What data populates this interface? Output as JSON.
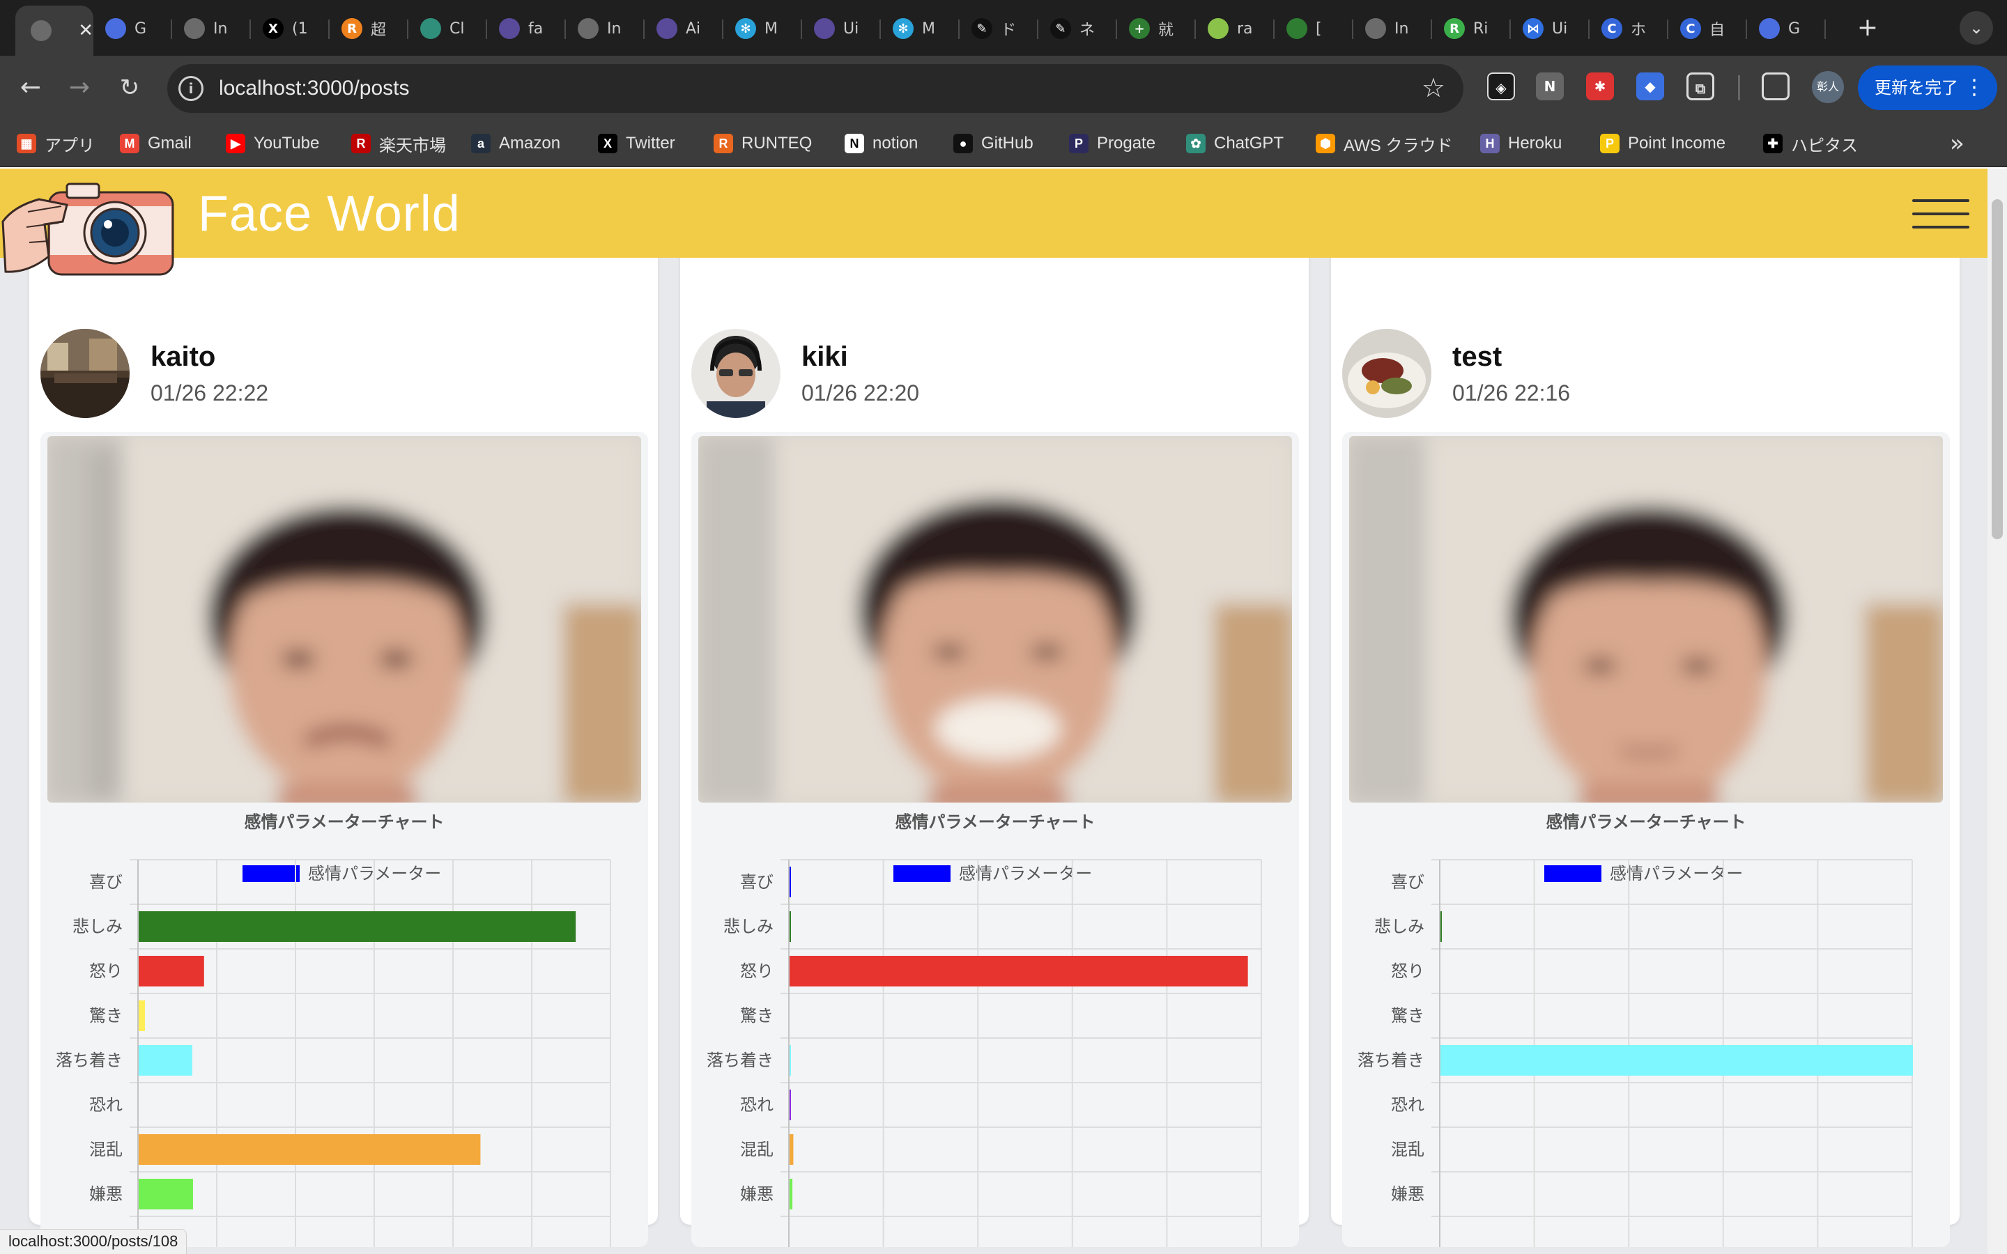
{
  "browser": {
    "tabs": [
      {
        "title": "",
        "icon": "globe-icon",
        "active": true
      },
      {
        "title": "G",
        "icon": "refresh-c-icon"
      },
      {
        "title": "In",
        "icon": "globe-icon"
      },
      {
        "title": "(1",
        "icon": "x-logo-icon"
      },
      {
        "title": "超",
        "icon": "r-logo-icon"
      },
      {
        "title": "Cl",
        "icon": "openai-icon"
      },
      {
        "title": "fa",
        "icon": "circle-icon"
      },
      {
        "title": "In",
        "icon": "globe-icon"
      },
      {
        "title": "Ai",
        "icon": "circle-icon"
      },
      {
        "title": "M",
        "icon": "snowflake-icon"
      },
      {
        "title": "Ui",
        "icon": "circle-icon"
      },
      {
        "title": "M",
        "icon": "snowflake-icon"
      },
      {
        "title": "ド",
        "icon": "feather-icon"
      },
      {
        "title": "ネ",
        "icon": "feather-icon"
      },
      {
        "title": "就",
        "icon": "plus-circle-icon"
      },
      {
        "title": "ra",
        "icon": "square-app-icon"
      },
      {
        "title": "[",
        "icon": "green-circle-icon"
      },
      {
        "title": "In",
        "icon": "globe-icon"
      },
      {
        "title": "Ri",
        "icon": "green-r-icon"
      },
      {
        "title": "Ui",
        "icon": "share-icon"
      },
      {
        "title": "ホ",
        "icon": "c-logo-icon"
      },
      {
        "title": "自",
        "icon": "c-logo-icon"
      },
      {
        "title": "G",
        "icon": "refresh-c-icon"
      }
    ],
    "url": "localhost:3000/posts",
    "update_button": "更新を完了",
    "profile": "彰人",
    "bookmarks": [
      {
        "label": "アプリ",
        "icon": "apps-grid-icon"
      },
      {
        "label": "Gmail",
        "icon": "gmail-icon"
      },
      {
        "label": "YouTube",
        "icon": "youtube-icon"
      },
      {
        "label": "楽天市場",
        "icon": "rakuten-icon"
      },
      {
        "label": "Amazon",
        "icon": "amazon-icon"
      },
      {
        "label": "Twitter",
        "icon": "x-logo-icon"
      },
      {
        "label": "RUNTEQ",
        "icon": "runteq-icon"
      },
      {
        "label": "notion",
        "icon": "notion-icon"
      },
      {
        "label": "GitHub",
        "icon": "github-icon"
      },
      {
        "label": "Progate",
        "icon": "progate-icon"
      },
      {
        "label": "ChatGPT",
        "icon": "openai-icon"
      },
      {
        "label": "AWS クラウド",
        "icon": "aws-icon"
      },
      {
        "label": "Heroku",
        "icon": "heroku-icon"
      },
      {
        "label": "Point Income",
        "icon": "point-income-icon"
      },
      {
        "label": "ハピタス",
        "icon": "hapitas-icon"
      }
    ],
    "status_url": "localhost:3000/posts/108"
  },
  "site": {
    "brand": "Face World",
    "colors": {
      "header": "#f3cc47",
      "brand_text": "#ffffff"
    }
  },
  "posts": [
    {
      "user": "kaito",
      "date": "01/26 22:22",
      "avatar": "dining-room-avatar"
    },
    {
      "user": "kiki",
      "date": "01/26 22:20",
      "avatar": "person-headset-avatar"
    },
    {
      "user": "test",
      "date": "01/26 22:16",
      "avatar": "food-plate-avatar"
    }
  ],
  "chart_data": [
    {
      "type": "bar",
      "orientation": "horizontal",
      "title": "感情パラメーターチャート",
      "legend": "感情パラメーター",
      "legend_color": "#0000ff",
      "categories": [
        "喜び",
        "悲しみ",
        "怒り",
        "驚き",
        "落ち着き",
        "恐れ",
        "混乱",
        "嫌悪"
      ],
      "values": [
        0,
        5550,
        830,
        80,
        680,
        0,
        4340,
        690
      ],
      "colors": [
        "#0000ff",
        "#2e7d22",
        "#e8342e",
        "#ffee58",
        "#7ef7ff",
        "#8a2be2",
        "#f4a93c",
        "#72f052"
      ],
      "xlim": [
        0,
        6000
      ],
      "xticks": [
        "0",
        "1,000",
        "2,000",
        "3,000",
        "4,000",
        "5,000",
        "6,000"
      ]
    },
    {
      "type": "bar",
      "orientation": "horizontal",
      "title": "感情パラメーターチャート",
      "legend": "感情パラメーター",
      "legend_color": "#0000ff",
      "categories": [
        "喜び",
        "悲しみ",
        "怒り",
        "驚き",
        "落ち着き",
        "恐れ",
        "混乱",
        "嫌悪"
      ],
      "values": [
        20,
        10,
        9700,
        0,
        5,
        10,
        80,
        60
      ],
      "colors": [
        "#0000ff",
        "#2e7d22",
        "#e8342e",
        "#ffee58",
        "#7ef7ff",
        "#8a2be2",
        "#f4a93c",
        "#72f052"
      ],
      "xlim": [
        0,
        10000
      ],
      "xticks": [
        "0",
        "2,000",
        "4,000",
        "6,000",
        "8,000",
        "10,000"
      ]
    },
    {
      "type": "bar",
      "orientation": "horizontal",
      "title": "感情パラメーターチャート",
      "legend": "感情パラメーター",
      "legend_color": "#0000ff",
      "categories": [
        "喜び",
        "悲しみ",
        "怒り",
        "驚き",
        "落ち着き",
        "恐れ",
        "混乱",
        "嫌悪"
      ],
      "values": [
        0,
        5,
        0,
        0,
        10000,
        0,
        0,
        0
      ],
      "colors": [
        "#0000ff",
        "#2e7d22",
        "#e8342e",
        "#ffee58",
        "#7ef7ff",
        "#8a2be2",
        "#f4a93c",
        "#72f052"
      ],
      "xlim": [
        0,
        10000
      ],
      "xticks": [
        "0",
        "2,000",
        "4,000",
        "6,000",
        "8,000",
        "10,000"
      ]
    }
  ]
}
